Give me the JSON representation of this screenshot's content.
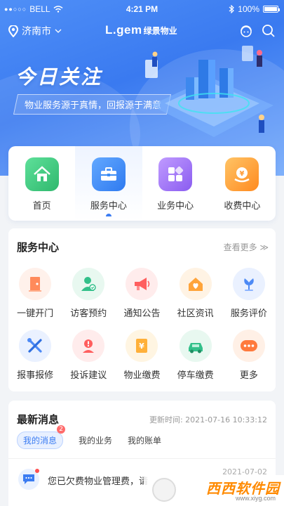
{
  "status_bar": {
    "carrier": "BELL",
    "time": "4:21 PM",
    "battery": "100%"
  },
  "header": {
    "city": "济南市",
    "logo_en": "L.gem",
    "logo_cn": "绿景物业"
  },
  "hero": {
    "title": "今日关注",
    "subtitle": "物业服务源于真情，回报源于满意"
  },
  "main_menu": [
    {
      "label": "首页",
      "icon": "home-icon",
      "color": "#3cc47c",
      "active": false
    },
    {
      "label": "服务中心",
      "icon": "toolbox-icon",
      "color": "#3b8cf5",
      "active": true
    },
    {
      "label": "业务中心",
      "icon": "grid-icon",
      "color": "#9b6cf0",
      "active": false
    },
    {
      "label": "收费中心",
      "icon": "coin-bag-icon",
      "color": "#ff9a33",
      "active": false
    }
  ],
  "service_center": {
    "title": "服务中心",
    "more_label": "查看更多",
    "items": [
      {
        "label": "一键开门",
        "icon": "door-icon",
        "color": "#ff8a5b",
        "bg": "#fff1eb"
      },
      {
        "label": "访客预约",
        "icon": "visitor-icon",
        "color": "#33c08a",
        "bg": "#e8f8f0"
      },
      {
        "label": "通知公告",
        "icon": "megaphone-icon",
        "color": "#ff5e5e",
        "bg": "#ffecec"
      },
      {
        "label": "社区资讯",
        "icon": "house-heart-icon",
        "color": "#ffa43a",
        "bg": "#fff3e4"
      },
      {
        "label": "服务评价",
        "icon": "flower-icon",
        "color": "#4d8af5",
        "bg": "#eaf1ff"
      },
      {
        "label": "报事报修",
        "icon": "wrench-icon",
        "color": "#4d8af5",
        "bg": "#eaf1ff"
      },
      {
        "label": "投诉建议",
        "icon": "complaint-icon",
        "color": "#ff5e5e",
        "bg": "#ffecec"
      },
      {
        "label": "物业缴费",
        "icon": "bill-icon",
        "color": "#ffb039",
        "bg": "#fff5e2"
      },
      {
        "label": "停车缴费",
        "icon": "car-icon",
        "color": "#33c08a",
        "bg": "#e8f8f0"
      },
      {
        "label": "更多",
        "icon": "more-icon",
        "color": "#ff7a3d",
        "bg": "#fff0e6"
      }
    ]
  },
  "news": {
    "title": "最新消息",
    "update_label": "更新时间:",
    "update_time": "2021-07-16 10:33:12",
    "tabs": [
      {
        "label": "我的消息",
        "badge": "2",
        "active": true
      },
      {
        "label": "我的业务",
        "badge": "",
        "active": false
      },
      {
        "label": "我的账单",
        "badge": "",
        "active": false
      }
    ],
    "message": {
      "text": "您已欠费物业管理费，请",
      "date": "2021-07-02"
    }
  },
  "watermark": {
    "text": "西西软件园",
    "url": "www.xiyg.com"
  }
}
